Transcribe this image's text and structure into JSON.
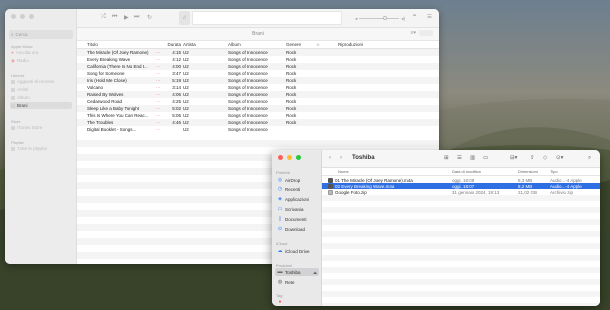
{
  "music": {
    "search_placeholder": "Cerca",
    "sidebar": {
      "sections": [
        "Apple Music",
        "Libreria",
        "Store",
        "Playlist"
      ],
      "apple_music_items": [
        "Ascolta ora",
        "Radio"
      ],
      "library_items": [
        "Aggiunti di recente",
        "Artisti",
        "Album",
        "Brani"
      ],
      "store_items": [
        "iTunes Store"
      ],
      "playlist_items": [
        "Tutte le playlist"
      ]
    },
    "toolbar": {
      "shuffle": "⤮",
      "prev": "⏮",
      "play": "▶",
      "next": "⏭",
      "repeat": "↻",
      "apple_logo": "",
      "lyrics": "❝",
      "queue": "☰",
      "airplay": "⌃"
    },
    "view_title": "Brani",
    "columns": {
      "title": "Titolo",
      "duration": "Durata",
      "artist": "Artista",
      "album": "Album",
      "genre": "Genere",
      "favorite": "☆",
      "plays": "Riproduzioni"
    },
    "tracks": [
      {
        "title": "The Miracle (Of Joey Ramone)",
        "dots": "···",
        "duration": "4:15",
        "artist": "U2",
        "album": "Songs of Innocence",
        "genre": "Rock"
      },
      {
        "title": "Every Breaking Wave",
        "dots": "···",
        "duration": "4:12",
        "artist": "U2",
        "album": "Songs of Innocence",
        "genre": "Rock"
      },
      {
        "title": "California (There Is No End t...",
        "dots": "···",
        "duration": "4:00",
        "artist": "U2",
        "album": "Songs of Innocence",
        "genre": "Rock"
      },
      {
        "title": "Song for Someone",
        "dots": "···",
        "duration": "3:47",
        "artist": "U2",
        "album": "Songs of Innocence",
        "genre": "Rock"
      },
      {
        "title": "Iris (Hold Me Close)",
        "dots": "···",
        "duration": "5:19",
        "artist": "U2",
        "album": "Songs of Innocence",
        "genre": "Rock"
      },
      {
        "title": "Volcano",
        "dots": "···",
        "duration": "3:14",
        "artist": "U2",
        "album": "Songs of Innocence",
        "genre": "Rock"
      },
      {
        "title": "Raised By Wolves",
        "dots": "···",
        "duration": "4:06",
        "artist": "U2",
        "album": "Songs of Innocence",
        "genre": "Rock"
      },
      {
        "title": "Cedarwood Road",
        "dots": "···",
        "duration": "4:25",
        "artist": "U2",
        "album": "Songs of Innocence",
        "genre": "Rock"
      },
      {
        "title": "Sleep Like a Baby Tonight",
        "dots": "···",
        "duration": "5:02",
        "artist": "U2",
        "album": "Songs of Innocence",
        "genre": "Rock"
      },
      {
        "title": "This Is Where You Can Reac...",
        "dots": "···",
        "duration": "5:05",
        "artist": "U2",
        "album": "Songs of Innocence",
        "genre": "Rock"
      },
      {
        "title": "The Troubles",
        "dots": "···",
        "duration": "4:46",
        "artist": "U2",
        "album": "Songs of Innocence",
        "genre": "Rock"
      },
      {
        "title": "Digital Booklet - Songs...",
        "dots": "···",
        "duration": "",
        "artist": "U2",
        "album": "Songs of Innocence",
        "genre": ""
      }
    ]
  },
  "finder": {
    "title": "Toshiba",
    "nav_back": "‹",
    "nav_forward": "›",
    "sidebar": {
      "sections": [
        "Preferiti",
        "iCloud",
        "Posizioni",
        "Tag"
      ],
      "favorites": [
        "AirDrop",
        "Recenti",
        "Applicazioni",
        "Scrivania",
        "Documenti",
        "Download"
      ],
      "icloud": [
        "iCloud Drive"
      ],
      "locations": [
        "Toshiba",
        "Rete"
      ],
      "eject": "⏏"
    },
    "columns": {
      "name": "Nome",
      "date": "Data di modifica",
      "size": "Dimensioni",
      "kind": "Tipo"
    },
    "files": [
      {
        "name": "01 The Miracle (Of Joey Ramone).m4a",
        "date": "oggi, 18:08",
        "size": "8,3 MB",
        "kind": "Audio...-4 Apple",
        "selected": false
      },
      {
        "name": "02 Every Breaking Wave.m4a",
        "date": "oggi, 18:07",
        "size": "8,2 MB",
        "kind": "Audio...-4 Apple",
        "selected": true
      },
      {
        "name": "Google Foto.zip",
        "date": "31 gennaio 2024, 19:13",
        "size": "21,02 GB",
        "kind": "Archivio zip",
        "selected": false
      }
    ]
  }
}
